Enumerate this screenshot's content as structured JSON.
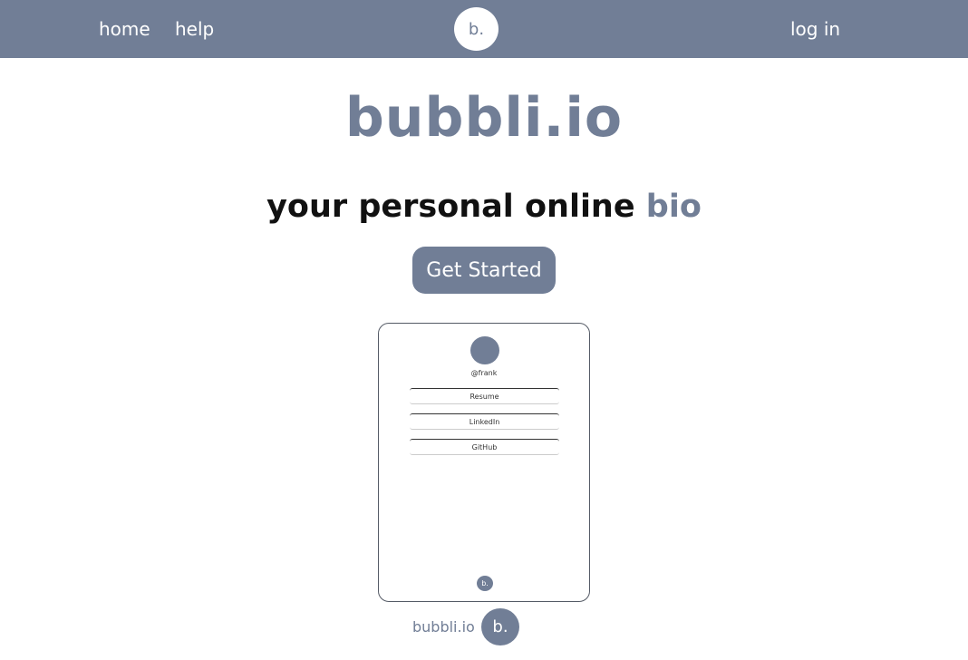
{
  "nav": {
    "home_label": "home",
    "help_label": "help",
    "logo_label": "b.",
    "login_label": "log in"
  },
  "hero": {
    "title": "bubbli.io",
    "tagline_prefix": "your personal online",
    "tagline_accent": "bio",
    "cta_label": "Get Started"
  },
  "preview": {
    "username": "@frank",
    "links": [
      "Resume",
      "LinkedIn",
      "GitHub"
    ],
    "badge_label": "b."
  },
  "footer": {
    "brand_text": "bubbli.io",
    "logo_label": "b."
  },
  "colors": {
    "accent": "#717e96",
    "background": "#ffffff",
    "text": "#111111"
  }
}
